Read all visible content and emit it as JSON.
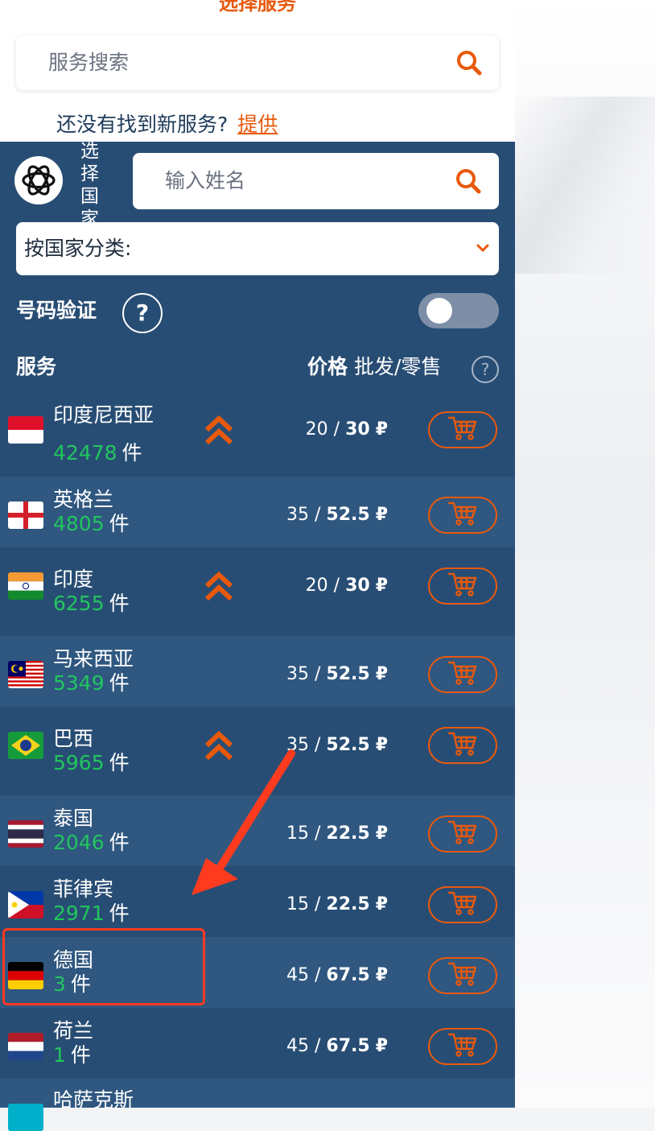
{
  "services": {
    "title": "选择服务",
    "search_placeholder": "服务搜索",
    "not_found_text": "还没有找到新服务?",
    "offer_link": "提供"
  },
  "countries_panel": {
    "select_country_label": "选择国家",
    "name_search_placeholder": "输入姓名",
    "sort_label": "按国家分类:",
    "number_verify_label": "号码验证",
    "help_mark": "?",
    "toggle_on": false
  },
  "table": {
    "header_service": "服务",
    "header_price": "价格",
    "header_price_sub": "批发/零售",
    "unit": "件",
    "currency": "₽",
    "rows": [
      {
        "name": "印度尼西亚",
        "count": "42478",
        "wholesale": "20",
        "retail": "30",
        "boost": true
      },
      {
        "name": "英格兰",
        "count": "4805",
        "wholesale": "35",
        "retail": "52.5",
        "boost": false
      },
      {
        "name": "印度",
        "count": "6255",
        "wholesale": "20",
        "retail": "30",
        "boost": true
      },
      {
        "name": "马来西亚",
        "count": "5349",
        "wholesale": "35",
        "retail": "52.5",
        "boost": false
      },
      {
        "name": "巴西",
        "count": "5965",
        "wholesale": "35",
        "retail": "52.5",
        "boost": true
      },
      {
        "name": "泰国",
        "count": "2046",
        "wholesale": "15",
        "retail": "22.5",
        "boost": false
      },
      {
        "name": "菲律宾",
        "count": "2971",
        "wholesale": "15",
        "retail": "22.5",
        "boost": false
      },
      {
        "name": "德国",
        "count": "3",
        "wholesale": "45",
        "retail": "67.5",
        "boost": false
      },
      {
        "name": "荷兰",
        "count": "1",
        "wholesale": "45",
        "retail": "67.5",
        "boost": false
      },
      {
        "name": "哈萨克斯",
        "count": "",
        "wholesale": "",
        "retail": "",
        "boost": false
      }
    ]
  },
  "colors": {
    "accent": "#e8590c",
    "panel": "#284d74",
    "panel_alt": "#2f5780",
    "count_green": "#22c55e",
    "annotation_red": "#ff3b1f"
  }
}
